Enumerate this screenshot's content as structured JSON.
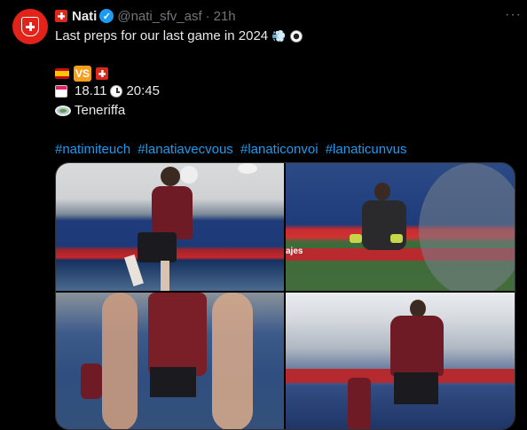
{
  "tweet": {
    "display_name": "Nati",
    "handle": "@nati_sfv_asf",
    "separator": "·",
    "time": "21h",
    "more_label": "···",
    "text_line1": "Last preps for our last game in 2024",
    "vs_label": "VS",
    "date": "18.11",
    "time_kickoff": "20:45",
    "venue": "Teneriffa",
    "hashtags": [
      "#natimiteuch",
      "#lanatiavecvous",
      "#lanaticonvoi",
      "#lanaticunvus"
    ],
    "photo_text": "ajes"
  },
  "icons": {
    "avatar": "swiss-crest-icon",
    "flag_ch": "swiss-flag-icon",
    "flag_es": "spain-flag-icon",
    "verified": "verified-badge-icon",
    "dash": "dash-icon",
    "ball": "soccer-ball-icon",
    "calendar": "calendar-icon",
    "clock": "clock-icon",
    "stadium": "stadium-icon"
  },
  "colors": {
    "background": "#000000",
    "text": "#e7e9ea",
    "muted": "#71767b",
    "link": "#1d9bf0",
    "swiss_red": "#da291c"
  }
}
